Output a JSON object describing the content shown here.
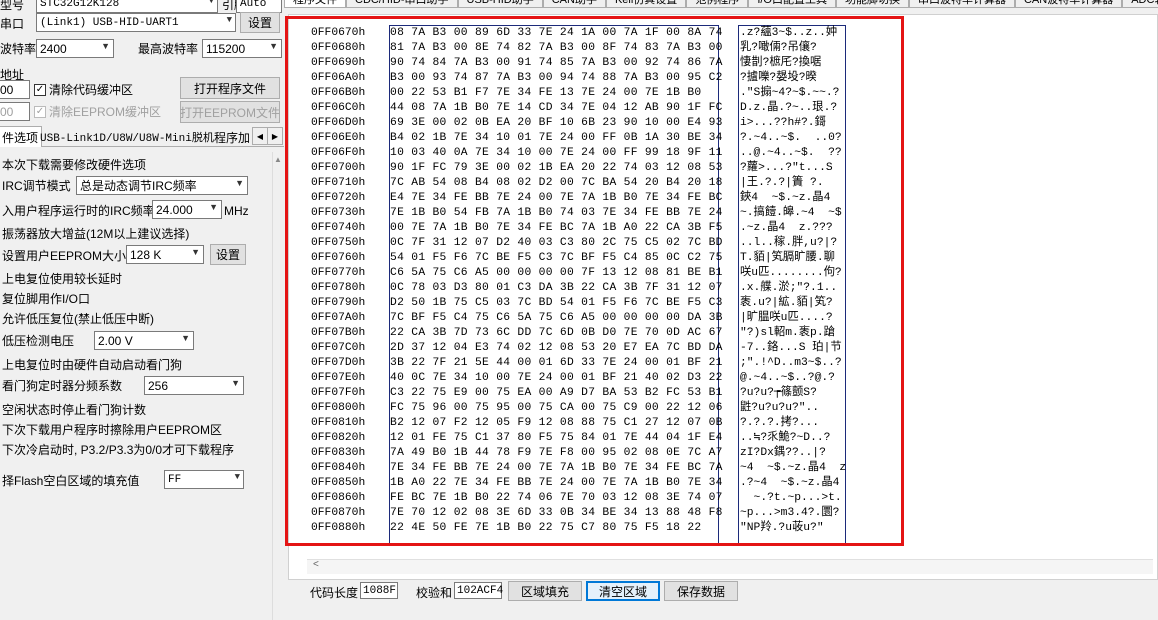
{
  "left": {
    "chip_label": "型号",
    "chip_value": "STC32G12K128",
    "freq_label": "引脚数",
    "freq_value": "Auto",
    "port_label": "串口",
    "port_value": "(Link1) USB-HID-UART1",
    "settings_button": "设置",
    "min_baud_label": "波特率",
    "min_baud_value": "2400",
    "max_baud_label": "最高波特率",
    "max_baud_value": "115200",
    "addr_label": "地址",
    "addr1_value": "00",
    "clear_code_buffer": "清除代码缓冲区",
    "open_program_file": "打开程序文件",
    "addr2_value": "00",
    "clear_eeprom_buffer": "清除EEPROM缓冲区",
    "open_eeprom_file": "打开EEPROM文件",
    "sub_tabs": [
      "件选项",
      "USB-Link1D/U8W/U8W-Mini脱机",
      "程序加"
    ],
    "options": {
      "hw_note": "本次下载需要修改硬件选项",
      "irc_mode_label": "IRC调节模式",
      "irc_mode_value": "总是动态调节IRC频率",
      "irc_freq_label": "入用户程序运行时的IRC频率",
      "irc_freq_value": "24.000",
      "irc_freq_unit": "MHz",
      "osc_gain": "振荡器放大增益(12M以上建议选择)",
      "eeprom_size_label": "设置用户EEPROM大小",
      "eeprom_size_value": "128  K",
      "eeprom_set_button": "设置",
      "long_reset": "上电复位使用较长延时",
      "reset_pin_io": "复位脚用作I/O口",
      "lvd_reset": "允许低压复位(禁止低压中断)",
      "lvd_voltage_label": "低压检测电压",
      "lvd_voltage_value": "2.00 V",
      "wdt_auto": "上电复位时由硬件自动启动看门狗",
      "wdt_prescale_label": "看门狗定时器分频系数",
      "wdt_prescale_value": "256",
      "wdt_idle_stop": "空闲状态时停止看门狗计数",
      "erase_eeprom_next": "下次下载用户程序时擦除用户EEPROM区",
      "cold_boot_note": "下次冷启动时, P3.2/P3.3为0/0才可下载程序",
      "flash_fill_label": "择Flash空白区域的填充值",
      "flash_fill_value": "FF"
    }
  },
  "tabs": [
    "程序文件",
    "CDC/HID-串口助手",
    "USB-HID助手",
    "CAN助手",
    "Keil仿真设置",
    "范例程序",
    "I/O口配置工具",
    "功能脚切换",
    "串口波特率计算器",
    "CAN波特率计算器",
    "ADC转换"
  ],
  "hex": {
    "addresses": [
      "0FF0670h",
      "0FF0680h",
      "0FF0690h",
      "0FF06A0h",
      "0FF06B0h",
      "0FF06C0h",
      "0FF06D0h",
      "0FF06E0h",
      "0FF06F0h",
      "0FF0700h",
      "0FF0710h",
      "0FF0720h",
      "0FF0730h",
      "0FF0740h",
      "0FF0750h",
      "0FF0760h",
      "0FF0770h",
      "0FF0780h",
      "0FF0790h",
      "0FF07A0h",
      "0FF07B0h",
      "0FF07C0h",
      "0FF07D0h",
      "0FF07E0h",
      "0FF07F0h",
      "0FF0800h",
      "0FF0810h",
      "0FF0820h",
      "0FF0830h",
      "0FF0840h",
      "0FF0850h",
      "0FF0860h",
      "0FF0870h",
      "0FF0880h"
    ],
    "bytes": [
      "08 7A B3 00 89 6D 33 7E 24 1A 00 7A 1F 00 8A 74",
      "81 7A B3 00 8E 74 82 7A B3 00 8F 74 83 7A B3 00",
      "90 74 84 7A B3 00 91 74 85 7A B3 00 92 74 86 7A",
      "B3 00 93 74 87 7A B3 00 94 74 88 7A B3 00 95 C2",
      "00 22 53 B1 F7 7E 34 FE 13 7E 24 00 7E 1B B0",
      "44 08 7A 1B B0 7E 14 CD 34 7E 04 12 AB 90 1F FC",
      "69 3E 00 02 0B EA 20 BF 10 6B 23 90 10 00 E4 93",
      "B4 02 1B 7E 34 10 01 7E 24 00 FF 0B 1A 30 BE 34",
      "10 03 40 0A 7E 34 10 00 7E 24 00 FF 99 18 9F 11",
      "90 1F FC 79 3E 00 02 1B EA 20 22 74 03 12 08 53",
      "7C AB 54 08 B4 08 02 D2 00 7C BA 54 20 B4 20 18",
      "E4 7E 34 FE BB 7E 24 00 7E 7A 1B B0 7E 34 FE BC",
      "7E 1B B0 54 FB 7A 1B B0 74 03 7E 34 FE BB 7E 24",
      "00 7E 7A 1B B0 7E 34 FE BC 7A 1B A0 22 CA 3B F5",
      "0C 7F 31 12 07 D2 40 03 C3 80 2C 75 C5 02 7C BD",
      "54 01 F5 F6 7C BE F5 C3 7C BF F5 C4 85 0C C2 75",
      "C6 5A 75 C6 A5 00 00 00 00 7F 13 12 08 81 BE B1",
      "0C 78 03 D3 80 01 C3 DA 3B 22 CA 3B 7F 31 12 07",
      "D2 50 1B 75 C5 03 7C BD 54 01 F5 F6 7C BE F5 C3",
      "7C BF F5 C4 75 C6 5A 75 C6 A5 00 00 00 00 DA 3B",
      "22 CA 3B 7D 73 6C DD 7C 6D 0B D0 7E 70 0D AC 67",
      "2D 37 12 04 E3 74 02 12 08 53 20 E7 EA 7C BD DA",
      "3B 22 7F 21 5E 44 00 01 6D 33 7E 24 00 01 BF 21",
      "40 0C 7E 34 10 00 7E 24 00 01 BF 21 40 02 D3 22",
      "C3 22 75 E9 00 75 EA 00 A9 D7 BA 53 B2 FC 53 B1",
      "FC 75 96 00 75 95 00 75 CA 00 75 C9 00 22 12 06",
      "B2 12 07 F2 12 05 F9 12 08 88 75 C1 27 12 07 0B",
      "12 01 FE 75 C1 37 80 F5 75 84 01 7E 44 04 1F E4",
      "7A 49 B0 1B 44 78 F9 7E F8 00 95 02 08 0E 7C A7",
      "7E 34 FE BB 7E 24 00 7E 7A 1B B0 7E 34 FE BC 7A",
      "1B A0 22 7E 34 FE BB 7E 24 00 7E 7A 1B B0 7E 34",
      "FE BC 7E 1B B0 22 74 06 7E 70 03 12 08 3E 74 07",
      "7E 70 12 02 08 3E 6D 33 0B 34 BE 34 13 88 48 F8",
      "22 4E 50 FE 7E 1B B0 22 75 C7 80 75 F5 18 22"
    ],
    "ascii": [
      ".z?蘊3~$..z..妕",
      "乳?噉倆?吊儴?",
      "悽剒?樜厇?換啹",
      "?摣嚛?嫢坄?暌",
      ".\"S搧~4?~$.~~.?",
      "D.z.晶.?~..珢.?",
      "i>...??h#?.鎶",
      "?.~4..~$.  ..0?",
      "..@.~4..~$.  ??",
      "?蘿>...?\"t...S",
      "|王.?.?|簀 ?.",
      "鋏4  ~$.~z.晶4",
      "~.搞饐.皞.~4  ~$",
      ".~z.晶4  z.???",
      "..l..稼.胖,u?|?",
      "T.貊|笂膈旷腰.聊",
      "咲u匹........佝?",
      ".x.艓.淤;\"?.1..",
      "袠.u?|絋.貊|笂?",
      "|旷腽咲u匹....?",
      "\"?)sl軺m.袠p.蹌",
      "-7..鉻...S 珀|节",
      ";\".!^D..m3~$..?",
      "@.~4..~$..?@.?",
      "?u?u?┮篠颤S?",
      "鼪?u?u?u?\"..",
      "?.?.?.拷?...",
      "..≒?乑鮠?~D..?",
      "zI?Dx鍝??..|?",
      "~4  ~$.~z.晶4  z",
      ".?~4  ~$.~z.晶4",
      "  ~.?t.~p...>t.",
      "~p...>m3.4?.圜?",
      "\"NP羚.?u荍u?\""
    ]
  },
  "bottom": {
    "code_len_label": "代码长度",
    "code_len_value": "1088F",
    "checksum_label": "校验和",
    "checksum_value": "102ACF4",
    "fill_region_button": "区域填充",
    "clear_region_button": "清空区域",
    "save_data_button": "保存数据"
  },
  "colors": {
    "highlight": "#e41414",
    "hex_border": "#1c2a7a",
    "focus": "#0078d7"
  }
}
